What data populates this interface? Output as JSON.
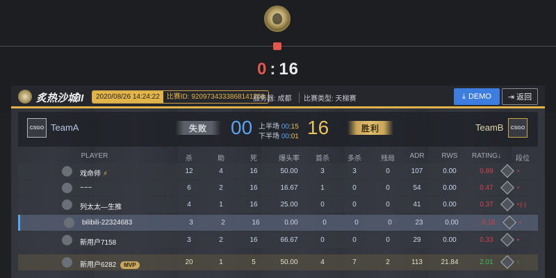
{
  "top": {
    "score_lose": "0",
    "score_sep": ":",
    "score_win": "16"
  },
  "match": {
    "map_name": "炙热沙城II",
    "date": "2020/08/26 14:24:22",
    "match_id": "比赛ID: 9209734333868141708",
    "server": "服务器: 成都",
    "type": "比赛类型: 天梯赛",
    "demo_label": "DEMO",
    "back_label": "返回"
  },
  "teams": {
    "a": {
      "name": "TeamA",
      "logo_text": "CSGO",
      "result": "失败",
      "score": "00"
    },
    "b": {
      "name": "TeamB",
      "logo_text": "CSGO",
      "result": "胜利",
      "score": "16"
    },
    "half1": {
      "label": "上半场",
      "a": "00",
      "sep": ":",
      "b": "15"
    },
    "half2": {
      "label": "下半场",
      "a": "00",
      "sep": ":",
      "b": "01"
    }
  },
  "table": {
    "headers": [
      "PLAYER",
      "杀",
      "助",
      "死",
      "爆头率",
      "首杀",
      "多杀",
      "残局",
      "ADR",
      "RWS",
      "RATING↓",
      "段位"
    ],
    "rows": [
      {
        "name": "戏命师",
        "extra": "⚡",
        "kills": "12",
        "assists": "4",
        "deaths": "16",
        "hs": "50.00",
        "first": "3",
        "multi": "3",
        "clutch": "0",
        "adr": "107",
        "rws": "0.00",
        "rating": "0.89",
        "rank_change": "+",
        "team": "a"
      },
      {
        "name": "~~~",
        "extra": "",
        "kills": "6",
        "assists": "2",
        "deaths": "16",
        "hs": "16.67",
        "first": "1",
        "multi": "0",
        "clutch": "0",
        "adr": "54",
        "rws": "0.00",
        "rating": "0.47",
        "rank_change": "+",
        "team": "a"
      },
      {
        "name": "列太太—生推",
        "extra": "",
        "kills": "4",
        "assists": "1",
        "deaths": "16",
        "hs": "25.00",
        "first": "0",
        "multi": "0",
        "clutch": "0",
        "adr": "41",
        "rws": "0.00",
        "rating": "0.37",
        "rank_change": "+(-)",
        "team": "a"
      },
      {
        "name": "bilibili-22324683",
        "extra": "",
        "kills": "3",
        "assists": "2",
        "deaths": "16",
        "hs": "0.00",
        "first": "0",
        "multi": "0",
        "clutch": "0",
        "adr": "23",
        "rws": "0.00",
        "rating": "0.16",
        "rank_change": "+",
        "team": "a"
      },
      {
        "name": "新用户7158",
        "extra": "",
        "kills": "3",
        "assists": "2",
        "deaths": "16",
        "hs": "66.67",
        "first": "0",
        "multi": "0",
        "clutch": "0",
        "adr": "29",
        "rws": "0.00",
        "rating": "0.33",
        "rank_change": "+",
        "team": "a"
      },
      {
        "name": "新用户6282",
        "extra": "MVP",
        "kills": "20",
        "assists": "1",
        "deaths": "5",
        "hs": "50.00",
        "first": "4",
        "multi": "7",
        "clutch": "2",
        "adr": "113",
        "rws": "21.84",
        "rating": "2.01",
        "rank_change": "↑",
        "team": "b"
      }
    ]
  }
}
